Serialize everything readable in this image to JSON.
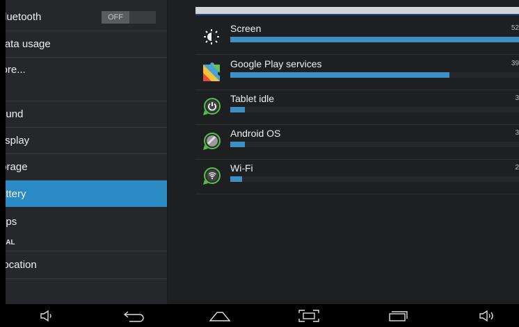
{
  "sidebar": {
    "bluetooth": {
      "label": "Bluetooth",
      "toggle": "OFF"
    },
    "items": [
      {
        "label": "Data usage"
      },
      {
        "label": "More..."
      },
      {
        "label": "Sound"
      },
      {
        "label": "Display"
      },
      {
        "label": "Storage"
      },
      {
        "label": "Battery"
      },
      {
        "label": "Apps"
      },
      {
        "label": "Location"
      }
    ],
    "section_personal": "PERSONAL"
  },
  "battery_usage": {
    "apps": [
      {
        "name": "Screen",
        "percent": "52",
        "fill": 1.0,
        "icon": "brightness-icon"
      },
      {
        "name": "Google Play services",
        "percent": "39",
        "fill": 0.76,
        "icon": "puzzle-icon"
      },
      {
        "name": "Tablet idle",
        "percent": "3",
        "fill": 0.05,
        "icon": "power-icon"
      },
      {
        "name": "Android OS",
        "percent": "3",
        "fill": 0.05,
        "icon": "android-icon"
      },
      {
        "name": "Wi-Fi",
        "percent": "2",
        "fill": 0.04,
        "icon": "wifi-icon"
      }
    ]
  },
  "colors": {
    "accent": "#2a8bc4",
    "bar": "#3d8fc6",
    "background": "#1e1f21"
  },
  "navbar": [
    "volume-down-icon",
    "back-icon",
    "home-icon",
    "screenshot-icon",
    "recents-icon",
    "volume-up-icon"
  ]
}
